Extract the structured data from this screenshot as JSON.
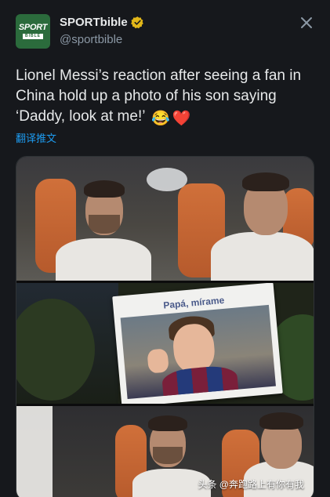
{
  "account": {
    "display_name": "SPORTbible",
    "handle": "@sportbible",
    "avatar_logo_top": "SPORT",
    "avatar_logo_bottom": "BIBLE",
    "verified": true
  },
  "colors": {
    "background": "#16181c",
    "text": "#e7e9ea",
    "secondary": "#8b98a5",
    "link": "#1d9bf0",
    "verified_badge": "#e2b719",
    "avatar": "#2b6b3c"
  },
  "tweet": {
    "text": "Lionel Messi’s reaction after seeing a fan in China hold up a photo of his son saying ‘Daddy, look at me!’",
    "emojis": [
      "😂",
      "❤️"
    ],
    "translate_label": "翻译推文"
  },
  "media": {
    "sign_caption": "Papá, mírame"
  },
  "watermark": {
    "text": "头条 @奔跑路上有你有我"
  },
  "icons": {
    "close": "close-icon",
    "verified": "verified-badge-icon"
  }
}
